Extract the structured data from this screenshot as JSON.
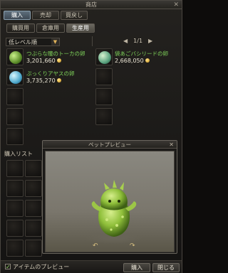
{
  "window": {
    "title": "商店",
    "close": "✕"
  },
  "tabs": [
    {
      "label": "購入",
      "active": true
    },
    {
      "label": "売却",
      "active": false
    },
    {
      "label": "買戻し",
      "active": false
    }
  ],
  "subtabs": [
    {
      "label": "購買用",
      "active": false
    },
    {
      "label": "倉庫用",
      "active": false
    },
    {
      "label": "生産用",
      "active": true
    }
  ],
  "sort": {
    "value": "低レベル順",
    "arrow": "▼"
  },
  "pager": {
    "prev": "◀",
    "page": "1/1",
    "next": "▶"
  },
  "items": [
    {
      "name": "つぶらな瞳のトーカの卵",
      "price": "3,201,660",
      "icon": "egg-green-icon"
    },
    {
      "name": "袋あごバシリードの卵",
      "price": "2,668,050",
      "icon": "egg-teal-icon"
    },
    {
      "name": "ぷっくりアヤスの卵",
      "price": "3,735,270",
      "icon": "egg-blue-icon"
    }
  ],
  "buy_list": {
    "label": "購入リスト"
  },
  "preview": {
    "title": "ペットプレビュー",
    "close": "✕",
    "rotate_left": "↶",
    "rotate_right": "↷"
  },
  "bottom": {
    "checkbox_mark": "✓",
    "checkbox_label": "アイテムのプレビュー",
    "buy_label": "購入",
    "close_label": "閉じる"
  },
  "colors": {
    "item_name": "#7fd45a",
    "active_tab": "#5f6f7c",
    "stage_bg": "#8a8880",
    "pet_green": "#8fbf3a"
  }
}
